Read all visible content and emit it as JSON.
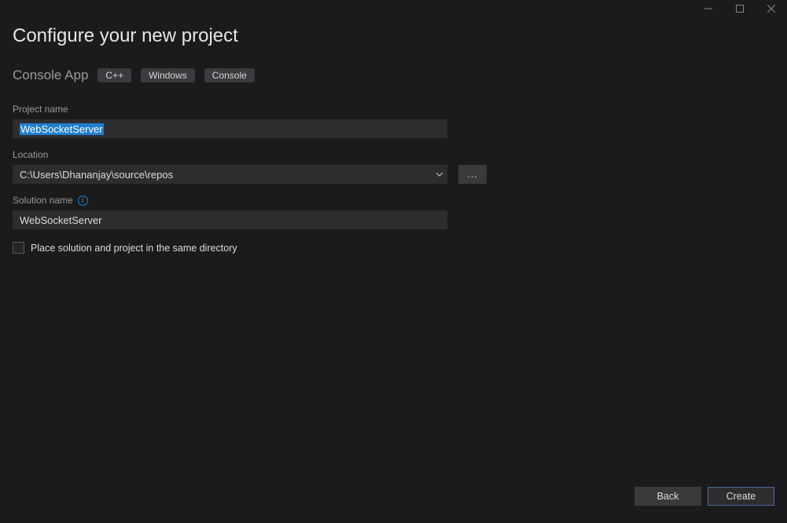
{
  "header": {
    "title": "Configure your new project",
    "subtitle": "Console App",
    "tags": [
      "C++",
      "Windows",
      "Console"
    ]
  },
  "fields": {
    "project_name": {
      "label": "Project name",
      "value": "WebSocketServer"
    },
    "location": {
      "label": "Location",
      "value": "C:\\Users\\Dhananjay\\source\\repos",
      "browse_label": "..."
    },
    "solution_name": {
      "label": "Solution name",
      "value": "WebSocketServer"
    },
    "same_directory": {
      "label": "Place solution and project in the same directory",
      "checked": false
    }
  },
  "footer": {
    "back": "Back",
    "create": "Create"
  }
}
